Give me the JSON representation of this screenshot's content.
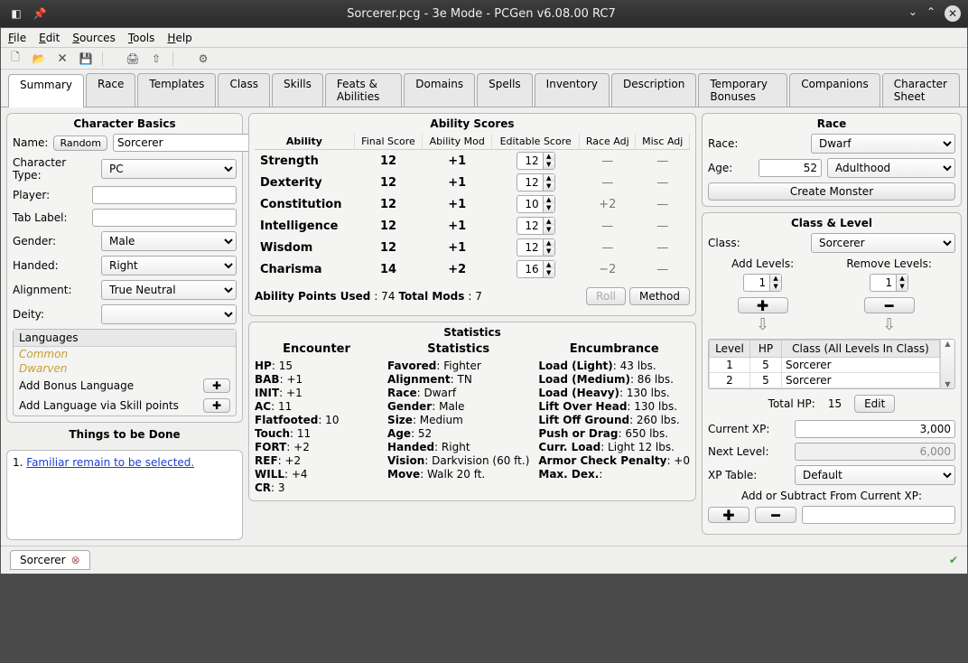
{
  "titlebar": {
    "title": "Sorcerer.pcg - 3e Mode - PCGen v6.08.00 RC7"
  },
  "menubar": [
    "File",
    "Edit",
    "Sources",
    "Tools",
    "Help"
  ],
  "tabs": [
    "Summary",
    "Race",
    "Templates",
    "Class",
    "Skills",
    "Feats & Abilities",
    "Domains",
    "Spells",
    "Inventory",
    "Description",
    "Temporary Bonuses",
    "Companions",
    "Character Sheet"
  ],
  "active_tab": "Summary",
  "basics": {
    "title": "Character Basics",
    "name_label": "Name:",
    "random_btn": "Random",
    "name_value": "Sorcerer",
    "chartype_label": "Character Type:",
    "chartype_value": "PC",
    "player_label": "Player:",
    "player_value": "",
    "tablabel_label": "Tab Label:",
    "tablabel_value": "",
    "gender_label": "Gender:",
    "gender_value": "Male",
    "handed_label": "Handed:",
    "handed_value": "Right",
    "alignment_label": "Alignment:",
    "alignment_value": "True Neutral",
    "deity_label": "Deity:",
    "deity_value": "",
    "languages_header": "Languages",
    "languages": [
      "Common",
      "Dwarven"
    ],
    "add_bonus_lang": "Add Bonus Language",
    "add_lang_skill": "Add Language via Skill points",
    "things_title": "Things to be Done",
    "things_item": "Familiar remain to be selected."
  },
  "ability": {
    "title": "Ability Scores",
    "headers": {
      "ability": "Ability",
      "final": "Final Score",
      "mod": "Ability Mod",
      "editable": "Editable Score",
      "radj": "Race Adj",
      "madj": "Misc Adj"
    },
    "rows": [
      {
        "name": "Strength",
        "final": "12",
        "mod": "+1",
        "edit": "12",
        "radj": "—",
        "madj": "—"
      },
      {
        "name": "Dexterity",
        "final": "12",
        "mod": "+1",
        "edit": "12",
        "radj": "—",
        "madj": "—"
      },
      {
        "name": "Constitution",
        "final": "12",
        "mod": "+1",
        "edit": "10",
        "radj": "+2",
        "madj": "—"
      },
      {
        "name": "Intelligence",
        "final": "12",
        "mod": "+1",
        "edit": "12",
        "radj": "—",
        "madj": "—"
      },
      {
        "name": "Wisdom",
        "final": "12",
        "mod": "+1",
        "edit": "12",
        "radj": "—",
        "madj": "—"
      },
      {
        "name": "Charisma",
        "final": "14",
        "mod": "+2",
        "edit": "16",
        "radj": "−2",
        "madj": "—"
      }
    ],
    "used_label": "Ability Points Used",
    "used_value": ": 74 ",
    "totalmods_label": "Total Mods",
    "totalmods_value": ": 7",
    "roll_btn": "Roll",
    "method_btn": "Method"
  },
  "stats": {
    "title": "Statistics",
    "encounter": {
      "h": "Encounter",
      "lines": [
        [
          "HP",
          ": 15"
        ],
        [
          "BAB",
          ": +1"
        ],
        [
          "INIT",
          ": +1"
        ],
        [
          "AC",
          ": 11"
        ],
        [
          "Flatfooted",
          ": 10"
        ],
        [
          "Touch",
          ": 11"
        ],
        [
          "FORT",
          ": +2"
        ],
        [
          "REF",
          ": +2"
        ],
        [
          "WILL",
          ": +4"
        ],
        [
          "CR",
          ": 3"
        ]
      ]
    },
    "statistics": {
      "h": "Statistics",
      "lines": [
        [
          "Favored",
          ": Fighter"
        ],
        [
          "Alignment",
          ": TN"
        ],
        [
          "Race",
          ": Dwarf"
        ],
        [
          "Gender",
          ": Male"
        ],
        [
          "Size",
          ": Medium"
        ],
        [
          "Age",
          ": 52"
        ],
        [
          "Handed",
          ": Right"
        ],
        [
          "Vision",
          ": Darkvision (60 ft.)"
        ],
        [
          "Move",
          ": Walk 20 ft."
        ]
      ]
    },
    "encumbrance": {
      "h": "Encumbrance",
      "lines": [
        [
          "Load (Light)",
          ": 43 lbs."
        ],
        [
          "Load (Medium)",
          ": 86 lbs."
        ],
        [
          "Load (Heavy)",
          ": 130 lbs."
        ],
        [
          "Lift Over Head",
          ": 130 lbs."
        ],
        [
          "Lift Off Ground",
          ": 260 lbs."
        ],
        [
          "Push or Drag",
          ": 650 lbs."
        ],
        [
          "Curr. Load",
          ": Light 12 lbs."
        ],
        [
          "Armor Check Penalty",
          ": +0"
        ],
        [
          "Max. Dex.",
          ": "
        ]
      ]
    }
  },
  "race": {
    "title": "Race",
    "race_label": "Race:",
    "race_value": "Dwarf",
    "age_label": "Age:",
    "age_value": "52",
    "age_cat": "Adulthood",
    "create_monster": "Create Monster"
  },
  "classlevel": {
    "title": "Class & Level",
    "class_label": "Class:",
    "class_value": "Sorcerer",
    "add_label": "Add Levels:",
    "remove_label": "Remove Levels:",
    "add_val": "1",
    "remove_val": "1",
    "table_headers": {
      "lvl": "Level",
      "hp": "HP",
      "cls": "Class (All Levels In Class)"
    },
    "rows": [
      {
        "lvl": "1",
        "hp": "5",
        "cls": "Sorcerer"
      },
      {
        "lvl": "2",
        "hp": "5",
        "cls": "Sorcerer"
      }
    ],
    "totalhp_label": "Total HP:",
    "totalhp_value": "15",
    "edit_btn": "Edit",
    "curxp_label": "Current XP:",
    "curxp_value": "3,000",
    "nextlvl_label": "Next Level:",
    "nextlvl_value": "6,000",
    "xptable_label": "XP Table:",
    "xptable_value": "Default",
    "adjust_xp_label": "Add or Subtract From Current XP:"
  },
  "bottom_tab": "Sorcerer"
}
